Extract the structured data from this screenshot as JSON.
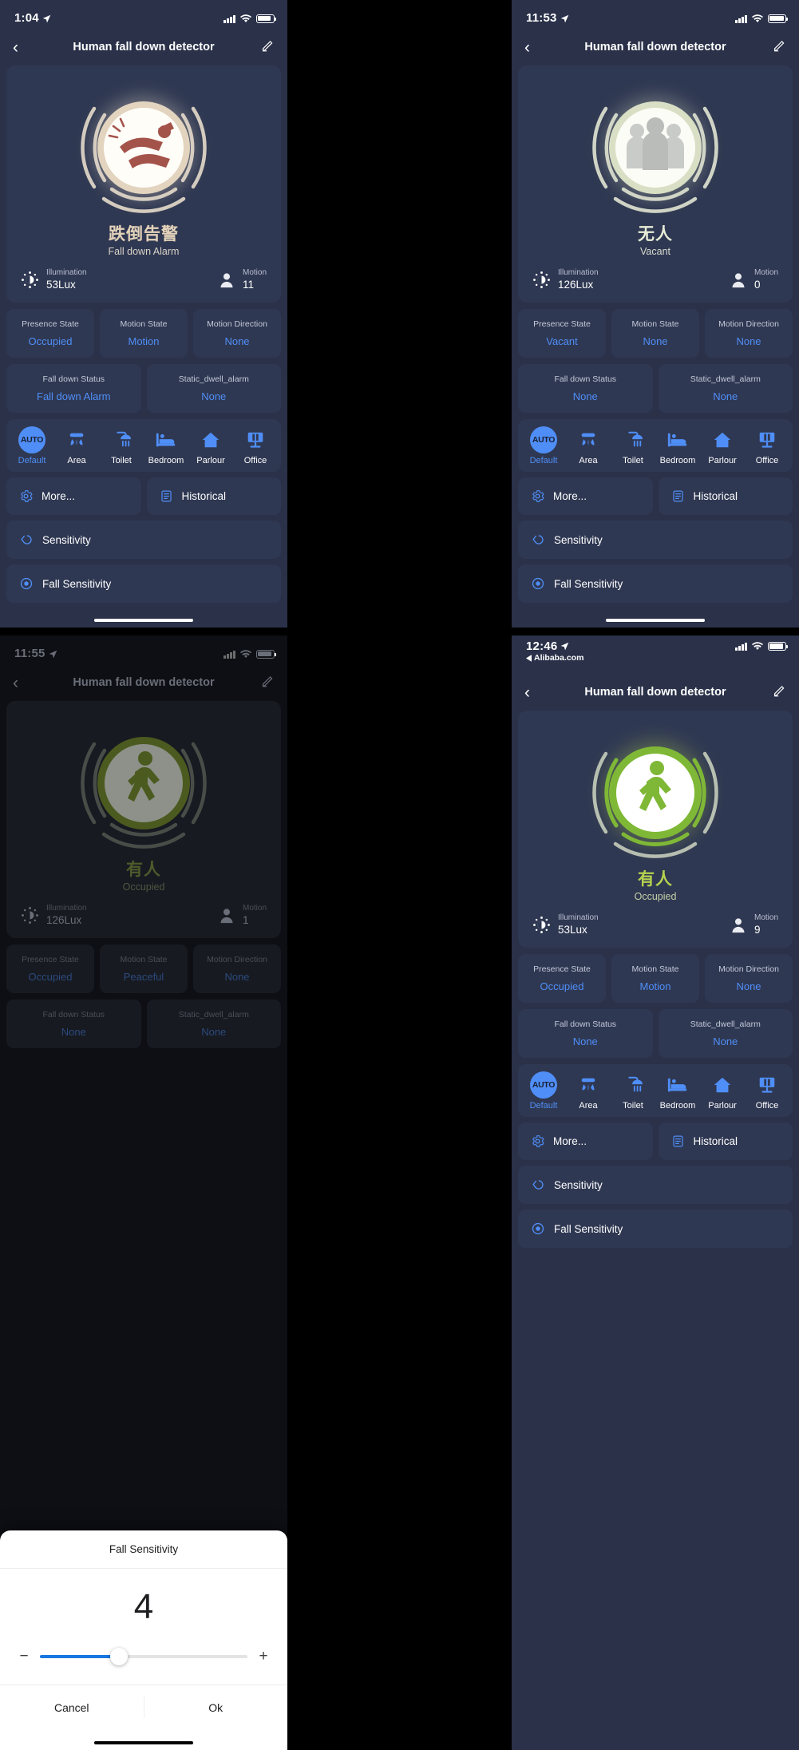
{
  "common": {
    "nav_title": "Human fall down detector",
    "back_icon": "chevron-left-icon",
    "edit_icon": "pencil-icon",
    "illumination_label": "Illumination",
    "motion_label": "Motion",
    "accent_blue": "#4f8ef7",
    "card_bg": "#2f3852",
    "panel_bg": "#2a3149",
    "state_labels": {
      "presence": "Presence State",
      "motion": "Motion State",
      "direction": "Motion Direction",
      "fall": "Fall down Status",
      "static": "Static_dwell_alarm"
    },
    "modes": [
      {
        "label": "Default",
        "icon": "auto-icon"
      },
      {
        "label": "Area",
        "icon": "area-sensor-icon"
      },
      {
        "label": "Toilet",
        "icon": "shower-icon"
      },
      {
        "label": "Bedroom",
        "icon": "bed-icon"
      },
      {
        "label": "Parlour",
        "icon": "house-icon"
      },
      {
        "label": "Office",
        "icon": "desk-monitor-icon"
      }
    ],
    "rows": {
      "more": "More...",
      "historical": "Historical",
      "sensitivity": "Sensitivity",
      "fall_sensitivity": "Fall Sensitivity"
    },
    "row_icons": {
      "more": "gear-icon",
      "historical": "document-list-icon",
      "sensitivity": "angle-brackets-icon",
      "fall_sensitivity": "target-circle-icon"
    }
  },
  "panels": {
    "p1": {
      "status": {
        "time": "1:04",
        "location_arrow": "➤",
        "subtitle": ""
      },
      "hero": {
        "cn": "跌倒告警",
        "en": "Fall down Alarm",
        "icon": "person-falling-icon",
        "theme": "alarm"
      },
      "illumination": "53Lux",
      "motion": "11",
      "states": {
        "presence": "Occupied",
        "motion": "Motion",
        "direction": "None",
        "fall": "Fall down Alarm",
        "static": "None"
      }
    },
    "p2": {
      "status": {
        "time": "11:53",
        "location_arrow": "➤",
        "subtitle": ""
      },
      "hero": {
        "cn": "无人",
        "en": "Vacant",
        "icon": "group-of-people-icon",
        "theme": "vacant"
      },
      "illumination": "126Lux",
      "motion": "0",
      "states": {
        "presence": "Vacant",
        "motion": "None",
        "direction": "None",
        "fall": "None",
        "static": "None"
      }
    },
    "p3": {
      "status": {
        "time": "11:55",
        "location_arrow": "➤",
        "subtitle": ""
      },
      "hero": {
        "cn": "有人",
        "en": "Occupied",
        "icon": "person-walking-icon",
        "theme": "occupied"
      },
      "illumination": "126Lux",
      "motion": "1",
      "states": {
        "presence": "Occupied",
        "motion": "Peaceful",
        "direction": "None",
        "fall": "None",
        "static": "None"
      },
      "modal": {
        "title": "Fall Sensitivity",
        "value": "4",
        "minus": "−",
        "plus": "+",
        "cancel": "Cancel",
        "ok": "Ok",
        "fill_percent": 38
      }
    },
    "p4": {
      "status": {
        "time": "12:46",
        "location_arrow": "➤",
        "subtitle": "Alibaba.com"
      },
      "hero": {
        "cn": "有人",
        "en": "Occupied",
        "icon": "person-walking-icon",
        "theme": "occupied"
      },
      "illumination": "53Lux",
      "motion": "9",
      "states": {
        "presence": "Occupied",
        "motion": "Motion",
        "direction": "None",
        "fall": "None",
        "static": "None"
      }
    }
  }
}
